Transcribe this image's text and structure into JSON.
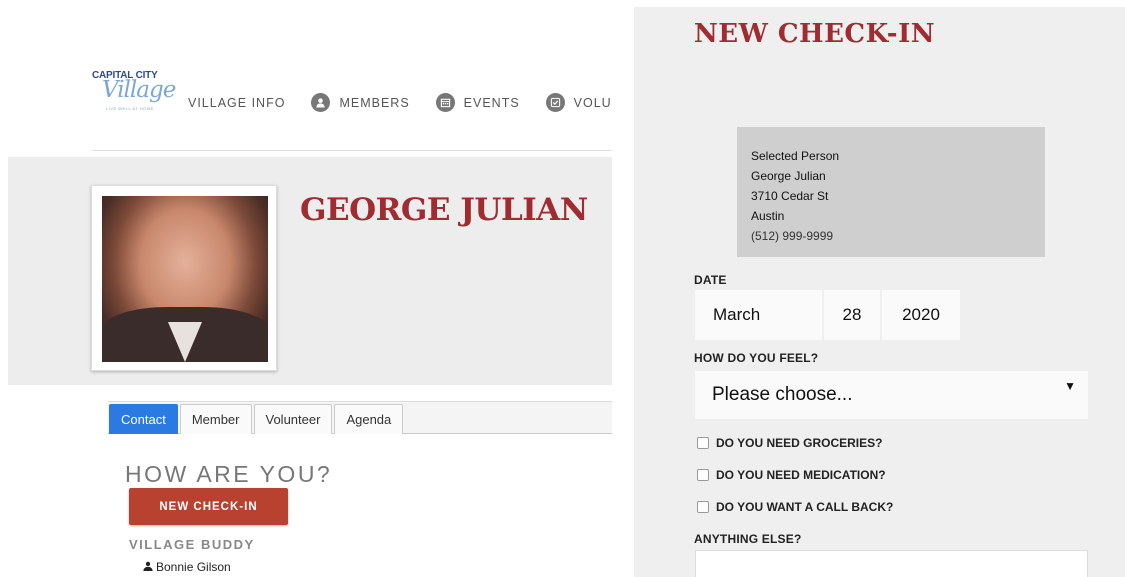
{
  "left_panel": {
    "logo": {
      "line1": "CAPITAL CITY",
      "line2": "Village",
      "tagline": "LIVE WELL AT HOME"
    },
    "nav": [
      {
        "label": "VILLAGE INFO",
        "icon": ""
      },
      {
        "label": "MEMBERS",
        "icon": "person-icon"
      },
      {
        "label": "EVENTS",
        "icon": "calendar-icon"
      },
      {
        "label": "VOLU",
        "icon": "check-icon"
      }
    ],
    "profile_name": "GEORGE JULIAN",
    "tabs": [
      {
        "label": "Contact",
        "active": true
      },
      {
        "label": "Member",
        "active": false
      },
      {
        "label": "Volunteer",
        "active": false
      },
      {
        "label": "Agenda",
        "active": false
      }
    ],
    "how_heading": "HOW ARE YOU?",
    "checkin_button": "NEW CHECK-IN",
    "buddy_heading": "VILLAGE BUDDY",
    "buddy_name": "Bonnie Gilson"
  },
  "right_panel": {
    "title": "NEW CHECK-IN",
    "selected_person": {
      "heading": "Selected Person",
      "name": "George Julian",
      "address": "3710 Cedar St",
      "city": "Austin",
      "phone": "(512) 999-9999"
    },
    "date_label": "DATE",
    "date": {
      "month": "March",
      "day": "28",
      "year": "2020"
    },
    "feel_label": "HOW DO YOU FEEL?",
    "feel_select": "Please choose...",
    "checkboxes": [
      {
        "label": "DO YOU NEED GROCERIES?",
        "checked": false
      },
      {
        "label": "DO YOU NEED MEDICATION?",
        "checked": false
      },
      {
        "label": "DO YOU WANT A CALL BACK?",
        "checked": false
      }
    ],
    "anything_label": "ANYTHING ELSE?",
    "anything_value": ""
  },
  "colors": {
    "brand_red": "#a02c32",
    "button_red": "#b8412f",
    "active_tab": "#2a7ae2",
    "panel_gray": "#efefef"
  }
}
